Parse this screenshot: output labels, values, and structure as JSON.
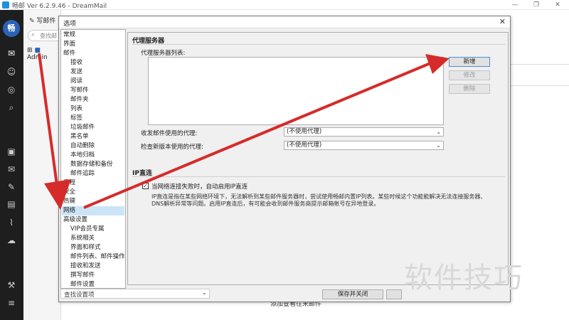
{
  "app": {
    "title": "畅邮 Ver 6.2.9.46 - DreamMail",
    "avatar_text": "畅",
    "compose_label": "写邮件",
    "search_placeholder": "查找邮",
    "account_label": "Admin",
    "bg_text": "添加查看往来邮件"
  },
  "window_controls": [
    "—",
    "❐",
    "✕"
  ],
  "dialog": {
    "title": "选项",
    "close": "✕",
    "tree": [
      "常规",
      "界面",
      "邮件",
      "接收",
      "发送",
      "阅读",
      "写邮件",
      "邮件夹",
      "列表",
      "标签",
      "垃圾邮件",
      "黑名单",
      "自动删除",
      "本地归档",
      "数据存储和备份",
      "邮件追踪",
      "日程",
      "安全",
      "热键",
      "网络",
      "高级设置",
      "VIP会员专属",
      "系统相关",
      "界面和样式",
      "邮件列表、邮件操作",
      "接收和发送",
      "撰写邮件",
      "邮件设置"
    ],
    "tree_search_placeholder": "查找设置项",
    "proxy_section_title": "代理服务器",
    "proxy_list_label": "代理服务器列表:",
    "btn_add": "新增",
    "btn_edit": "修改",
    "btn_delete": "删除",
    "mail_proxy_label": "收发邮件使用的代理:",
    "mail_proxy_value": "(不使用代理)",
    "update_proxy_label": "检查新版本使用的代理:",
    "update_proxy_value": "(不使用代理)",
    "ip_section_title": "IP直连",
    "ip_checkbox_label": "当网络连接失败时，自动启用IP直连",
    "ip_checkbox_checked": true,
    "ip_desc": "IP直连是指在某些网络环境下，无法解析到某些邮件服务器时，尝试使用畅邮内置IP列表。某些时候这个功能能解决无法连接服务器、DNS解析异常等问题。启用IP直连后，有可能会收到邮件服务商提示邮箱帐号在异地登录。",
    "btn_save_close": "保存并关闭"
  },
  "watermark": "软件技巧",
  "colors": {
    "arrow": "#d62b2b",
    "selection": "#cce4f7",
    "rail": "#1e1e1e"
  }
}
